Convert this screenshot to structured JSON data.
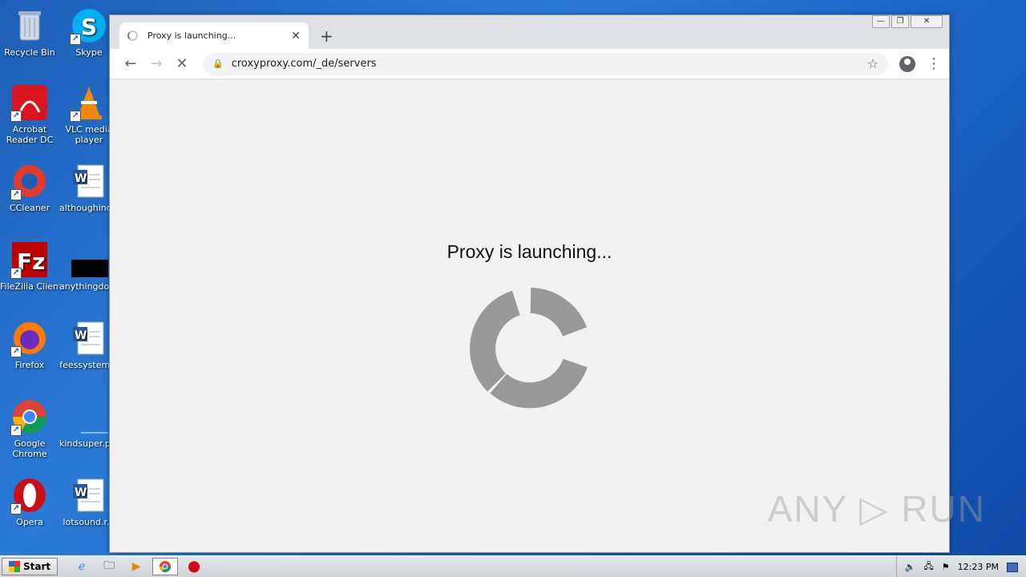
{
  "desktop": {
    "icons": [
      {
        "label": "Recycle Bin"
      },
      {
        "label": "Skype"
      },
      {
        "label": "Acrobat Reader DC"
      },
      {
        "label": "VLC media player"
      },
      {
        "label": "CCleaner"
      },
      {
        "label": "althoughind..."
      },
      {
        "label": "FileZilla Client"
      },
      {
        "label": "anythingdoi..."
      },
      {
        "label": "Firefox"
      },
      {
        "label": "feessystem..."
      },
      {
        "label": "Google Chrome"
      },
      {
        "label": "kindsuper.p..."
      },
      {
        "label": "Opera"
      },
      {
        "label": "lotsound.r..."
      }
    ]
  },
  "browser": {
    "tab_title": "Proxy is launching...",
    "tab_close": "✕",
    "new_tab": "+",
    "url": "croxyproxy.com/_de/servers",
    "back": "←",
    "forward": "→",
    "stop": "✕",
    "star": "☆",
    "menu": "⋮"
  },
  "page": {
    "heading": "Proxy is launching..."
  },
  "watermark": "ANY ▷ RUN",
  "taskbar": {
    "start_label": "Start",
    "clock": "12:23 PM"
  },
  "window_controls": {
    "minimize": "—",
    "restore": "❐",
    "close": "✕"
  }
}
